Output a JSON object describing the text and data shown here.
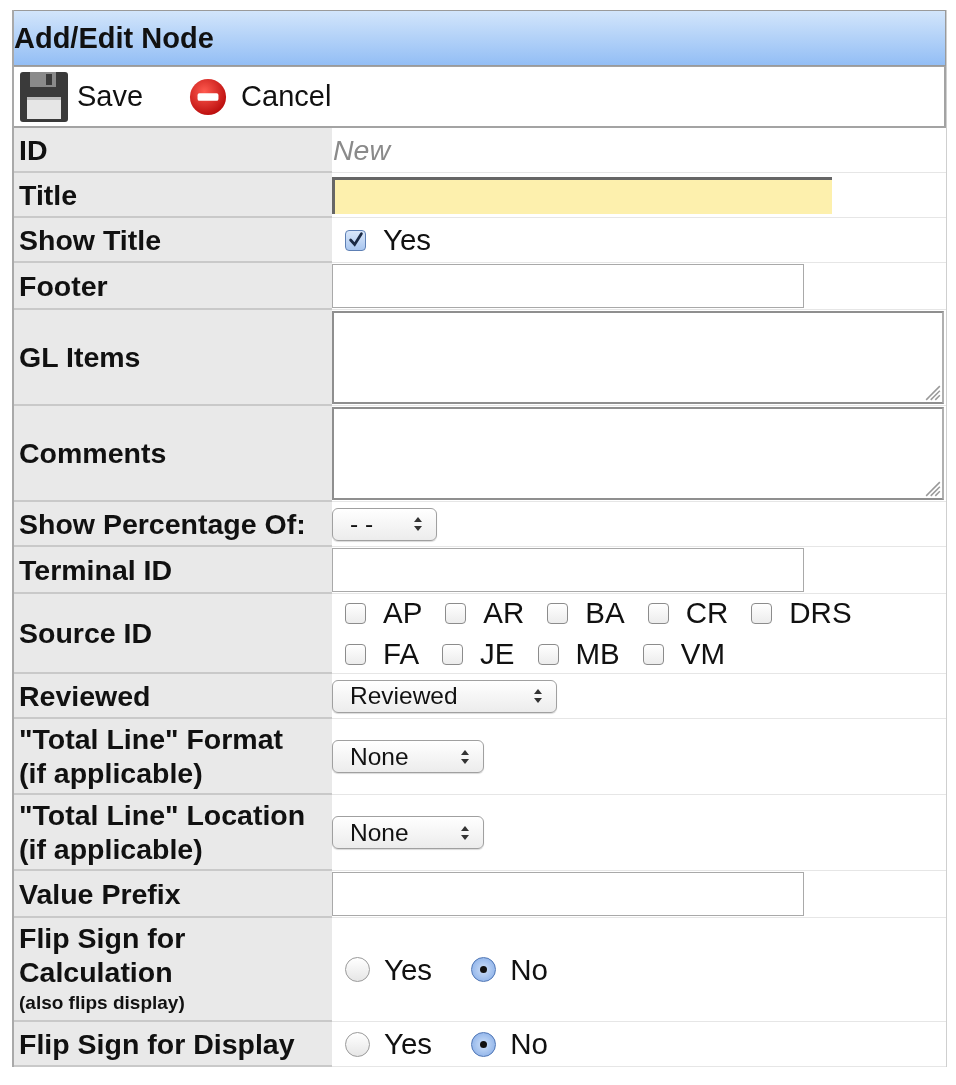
{
  "panel": {
    "title": "Add/Edit Node"
  },
  "toolbar": [
    {
      "kind": "save",
      "label": "Save"
    },
    {
      "kind": "cancel",
      "label": "Cancel"
    }
  ],
  "fields": [
    {
      "kind": "static",
      "label": "ID",
      "value": "New"
    },
    {
      "kind": "text",
      "label": "Title",
      "highlighted": true
    },
    {
      "kind": "checkbox",
      "label": "Show Title",
      "options": [
        {
          "label": "Yes",
          "checked": true
        }
      ]
    },
    {
      "kind": "text",
      "label": "Footer",
      "highlighted": false
    },
    {
      "kind": "textarea",
      "label": "GL Items"
    },
    {
      "kind": "textarea",
      "label": "Comments"
    },
    {
      "kind": "select",
      "label": "Show Percentage Of:",
      "value": "- -"
    },
    {
      "kind": "text",
      "label": "Terminal ID",
      "highlighted": false
    },
    {
      "kind": "checkbox",
      "label": "Source ID",
      "options": [
        {
          "label": "AP",
          "checked": false
        },
        {
          "label": "AR",
          "checked": false
        },
        {
          "label": "BA",
          "checked": false
        },
        {
          "label": "CR",
          "checked": false
        },
        {
          "label": "DRS",
          "checked": false
        },
        {
          "label": "FA",
          "checked": false
        },
        {
          "label": "JE",
          "checked": false
        },
        {
          "label": "MB",
          "checked": false
        },
        {
          "label": "VM",
          "checked": false
        }
      ]
    },
    {
      "kind": "select",
      "label": "Reviewed",
      "value": "Reviewed"
    },
    {
      "kind": "select",
      "label": "\"Total Line\" Format (if applicable)",
      "value": "None"
    },
    {
      "kind": "select",
      "label": "\"Total Line\" Location (if applicable)",
      "value": "None"
    },
    {
      "kind": "text",
      "label": "Value Prefix",
      "highlighted": false
    },
    {
      "kind": "radio",
      "label": "Flip Sign for Calculation",
      "note": "(also flips display)",
      "options": [
        {
          "label": "Yes",
          "selected": false
        },
        {
          "label": "No",
          "selected": true
        }
      ]
    },
    {
      "kind": "radio",
      "label": "Flip Sign for Display",
      "options": [
        {
          "label": "Yes",
          "selected": false
        },
        {
          "label": "No",
          "selected": true
        }
      ]
    }
  ]
}
